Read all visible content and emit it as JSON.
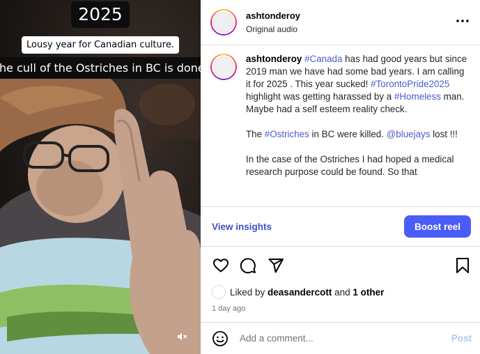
{
  "media": {
    "caption_year": "2025",
    "caption_line1": "Lousy year for Canadian culture.",
    "caption_line2": "The cull of the Ostriches in BC is done.",
    "mute_icon": "speaker-muted-icon"
  },
  "header": {
    "username": "ashtonderoy",
    "audio_label": "Original audio",
    "more_icon": "more-horizontal-icon"
  },
  "post": {
    "author": "ashtonderoy",
    "paragraph1": [
      {
        "text": " ",
        "type": "plain"
      },
      {
        "text": "#Canada",
        "type": "tag"
      },
      {
        "text": " has had good years but since 2019 man we have had some bad years. I am calling it for 2025 . This year sucked! ",
        "type": "plain"
      },
      {
        "text": "#TorontoPride2025",
        "type": "tag"
      },
      {
        "text": " highlight was getting harassed by a ",
        "type": "plain"
      },
      {
        "text": "#Homeless",
        "type": "tag"
      },
      {
        "text": " man. Maybe had a self esteem reality check.",
        "type": "plain"
      }
    ],
    "paragraph2": [
      {
        "text": "The ",
        "type": "plain"
      },
      {
        "text": "#Ostriches",
        "type": "tag"
      },
      {
        "text": " in BC were killed. ",
        "type": "plain"
      },
      {
        "text": "@bluejays",
        "type": "tag"
      },
      {
        "text": " lost !!!",
        "type": "plain"
      }
    ],
    "paragraph3": "In the case of the Ostriches I had hoped a medical research purpose could be found. So that"
  },
  "insights": {
    "view_label": "View insights",
    "boost_label": "Boost reel"
  },
  "actions": {
    "icons": [
      "heart-icon",
      "comment-icon",
      "share-icon",
      "bookmark-icon"
    ],
    "liked_by_prefix": "Liked by ",
    "liked_by_user": "deasandercott",
    "liked_by_and": " and ",
    "liked_by_other": "1 other",
    "timestamp": "1 day ago"
  },
  "comment_box": {
    "placeholder": "Add a comment...",
    "post_label": "Post",
    "emoji_icon": "emoji-icon"
  },
  "colors": {
    "accent": "#4a5df9",
    "link": "#3f51c7",
    "border": "#dbdbdb",
    "post_disabled": "#b2c6f3"
  }
}
